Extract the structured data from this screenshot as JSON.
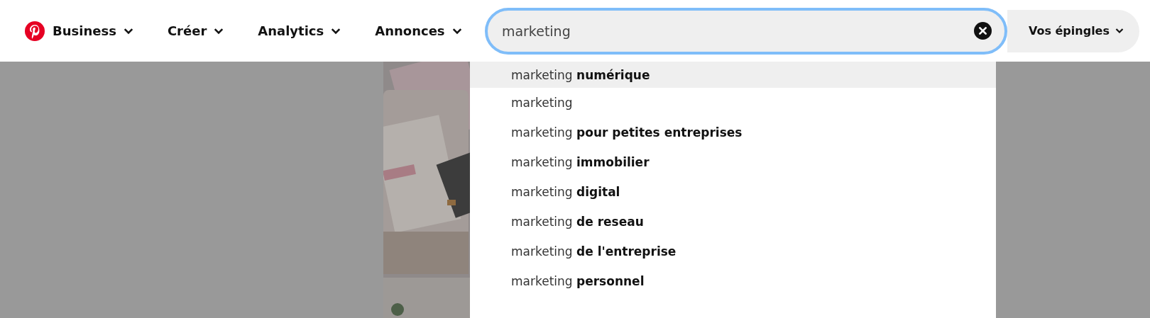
{
  "nav": [
    {
      "label": "Business"
    },
    {
      "label": "Créer"
    },
    {
      "label": "Analytics"
    },
    {
      "label": "Annonces"
    }
  ],
  "search": {
    "value": "marketing"
  },
  "account_button": {
    "label": "Vos épingles"
  },
  "suggestions": [
    {
      "text": "marketing **numérique**",
      "selected": true
    },
    {
      "text": "marketing",
      "selected": false
    },
    {
      "text": "marketing **pour petites entreprises**",
      "selected": false
    },
    {
      "text": "marketing **immobilier**",
      "selected": false
    },
    {
      "text": "marketing **digital**",
      "selected": false
    },
    {
      "text": "marketing **de reseau**",
      "selected": false
    },
    {
      "text": "marketing **de l'entreprise**",
      "selected": false
    },
    {
      "text": "marketing **personnel**",
      "selected": false
    }
  ]
}
